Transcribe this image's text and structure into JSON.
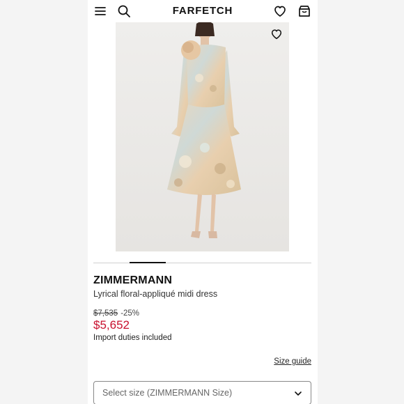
{
  "header": {
    "logo": "FARFETCH",
    "icons": [
      "menu-icon",
      "search-icon",
      "heart-icon",
      "bag-icon"
    ]
  },
  "product": {
    "brand": "ZIMMERMANN",
    "name": "Lyrical floral-appliqué midi dress",
    "original_price": "$7,535",
    "discount": "-25%",
    "price": "$5,652",
    "duties_note": "Import duties included",
    "image_index": 1
  },
  "size": {
    "guide_label": "Size guide",
    "select_placeholder": "Select size (ZIMMERMANN Size)"
  },
  "colors": {
    "sale_price": "#c8102e",
    "text": "#222222",
    "image_background": "#ecebe9"
  }
}
